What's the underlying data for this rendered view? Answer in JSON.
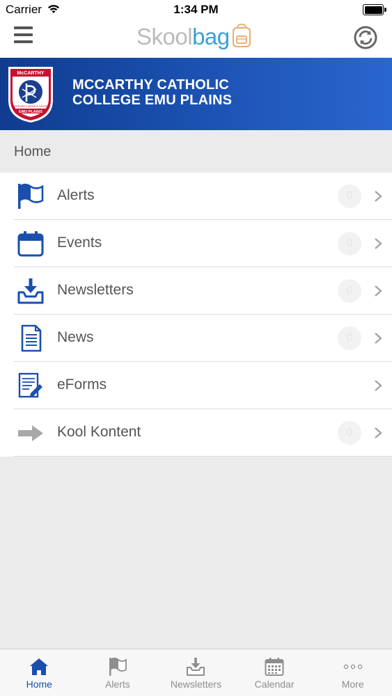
{
  "status_bar": {
    "carrier": "Carrier",
    "time": "1:34 PM"
  },
  "header": {
    "brand_part1": "Skool",
    "brand_part2": "bag",
    "menu_icon": "hamburger-icon",
    "sync_icon": "refresh-icon"
  },
  "banner": {
    "school_line1": "MCCARTHY CATHOLIC",
    "school_line2": "COLLEGE EMU PLAINS",
    "crest_text_top": "McCARTHY",
    "crest_text_bottom": "EMU PLAINS"
  },
  "breadcrumb": {
    "label": "Home"
  },
  "menu": {
    "items": [
      {
        "label": "Alerts",
        "icon": "flag-icon",
        "badge": "0"
      },
      {
        "label": "Events",
        "icon": "calendar-icon",
        "badge": "0"
      },
      {
        "label": "Newsletters",
        "icon": "inbox-download-icon",
        "badge": "0"
      },
      {
        "label": "News",
        "icon": "document-icon",
        "badge": "0"
      },
      {
        "label": "eForms",
        "icon": "form-pencil-icon",
        "badge": ""
      },
      {
        "label": "Kool Kontent",
        "icon": "arrow-right-icon",
        "badge": "0"
      }
    ]
  },
  "tabs": [
    {
      "label": "Home",
      "icon": "home-icon",
      "active": true
    },
    {
      "label": "Alerts",
      "icon": "flag-icon",
      "active": false
    },
    {
      "label": "Newsletters",
      "icon": "inbox-download-icon",
      "active": false
    },
    {
      "label": "Calendar",
      "icon": "calendar-grid-icon",
      "active": false
    },
    {
      "label": "More",
      "icon": "more-dots-icon",
      "active": false
    }
  ],
  "colors": {
    "brand_blue": "#1a4fae",
    "banner_dark": "#0f3c8f",
    "brand_bag": "#3aa0d8",
    "text_gray": "#555555",
    "tab_inactive": "#8e8e8e"
  }
}
